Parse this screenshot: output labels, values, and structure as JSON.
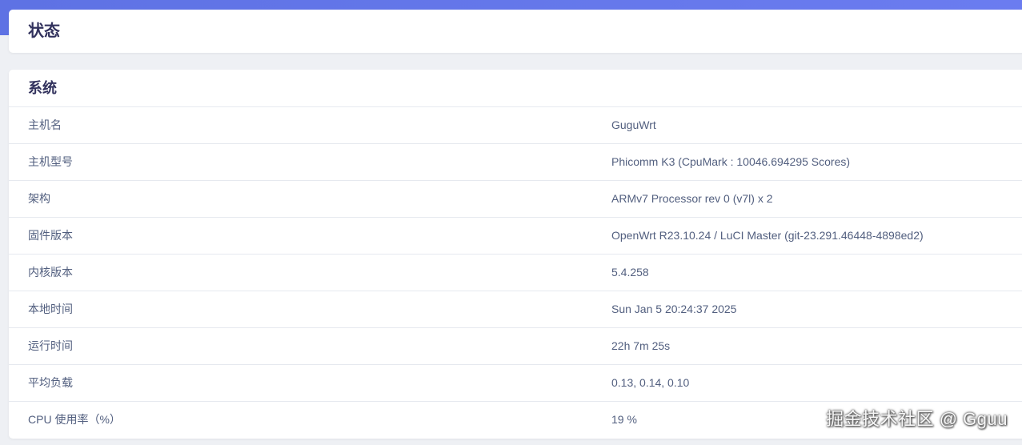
{
  "page": {
    "title": "状态"
  },
  "system": {
    "section_title": "系统",
    "rows": [
      {
        "label": "主机名",
        "value": "GuguWrt"
      },
      {
        "label": "主机型号",
        "value": "Phicomm K3 (CpuMark : 10046.694295 Scores)"
      },
      {
        "label": "架构",
        "value": "ARMv7 Processor rev 0 (v7l) x 2"
      },
      {
        "label": "固件版本",
        "value": "OpenWrt R23.10.24 / LuCI Master (git-23.291.46448-4898ed2)"
      },
      {
        "label": "内核版本",
        "value": "5.4.258"
      },
      {
        "label": "本地时间",
        "value": "Sun Jan 5 20:24:37 2025"
      },
      {
        "label": "运行时间",
        "value": "22h 7m 25s"
      },
      {
        "label": "平均负载",
        "value": "0.13, 0.14, 0.10"
      },
      {
        "label": "CPU 使用率（%）",
        "value": "19 %"
      }
    ]
  },
  "watermark": {
    "text": "掘金技术社区 @ Gguu"
  },
  "colors": {
    "header_band": "#5e72e4",
    "title_text": "#32325d",
    "row_text": "#525f7f",
    "background": "#eef0f4"
  }
}
